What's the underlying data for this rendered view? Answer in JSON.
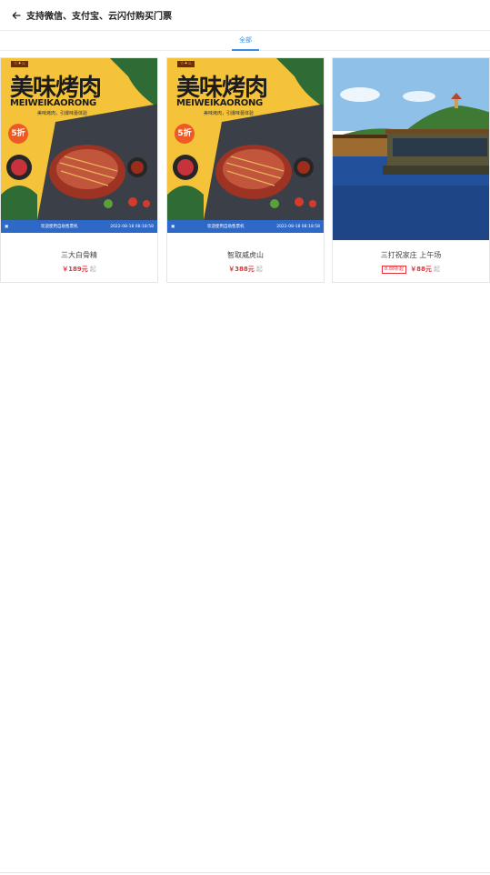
{
  "header": {
    "title": "支持微信、支付宝、云闪付购买门票"
  },
  "tabs": [
    {
      "label": "全部",
      "active": true
    }
  ],
  "poster": {
    "title": "美味烤肉",
    "subtitle": "MEIWEIKAORONG",
    "tagline": "美味烤肉，引爆味蕾体验",
    "badge": "5折",
    "bar_text": "欢迎使用自助售票机",
    "bar_datetime": "2022-08-18 08:18:58"
  },
  "products": [
    {
      "name": "三大白骨精",
      "price": "￥189元",
      "price_suffix": "起",
      "discount": "",
      "image": "bbq-poster"
    },
    {
      "name": "智取威虎山",
      "price": "￥388元",
      "price_suffix": "起",
      "discount": "",
      "image": "bbq-poster"
    },
    {
      "name": "三打祝家庄 上午场",
      "price": "￥88元",
      "price_suffix": "起",
      "discount": "8.88折起",
      "image": "lake-boat-photo"
    }
  ],
  "colors": {
    "accent": "#3a8ee6",
    "price": "#e5343b",
    "poster_yellow": "#f4c33a",
    "poster_bar": "#2f69c8"
  }
}
